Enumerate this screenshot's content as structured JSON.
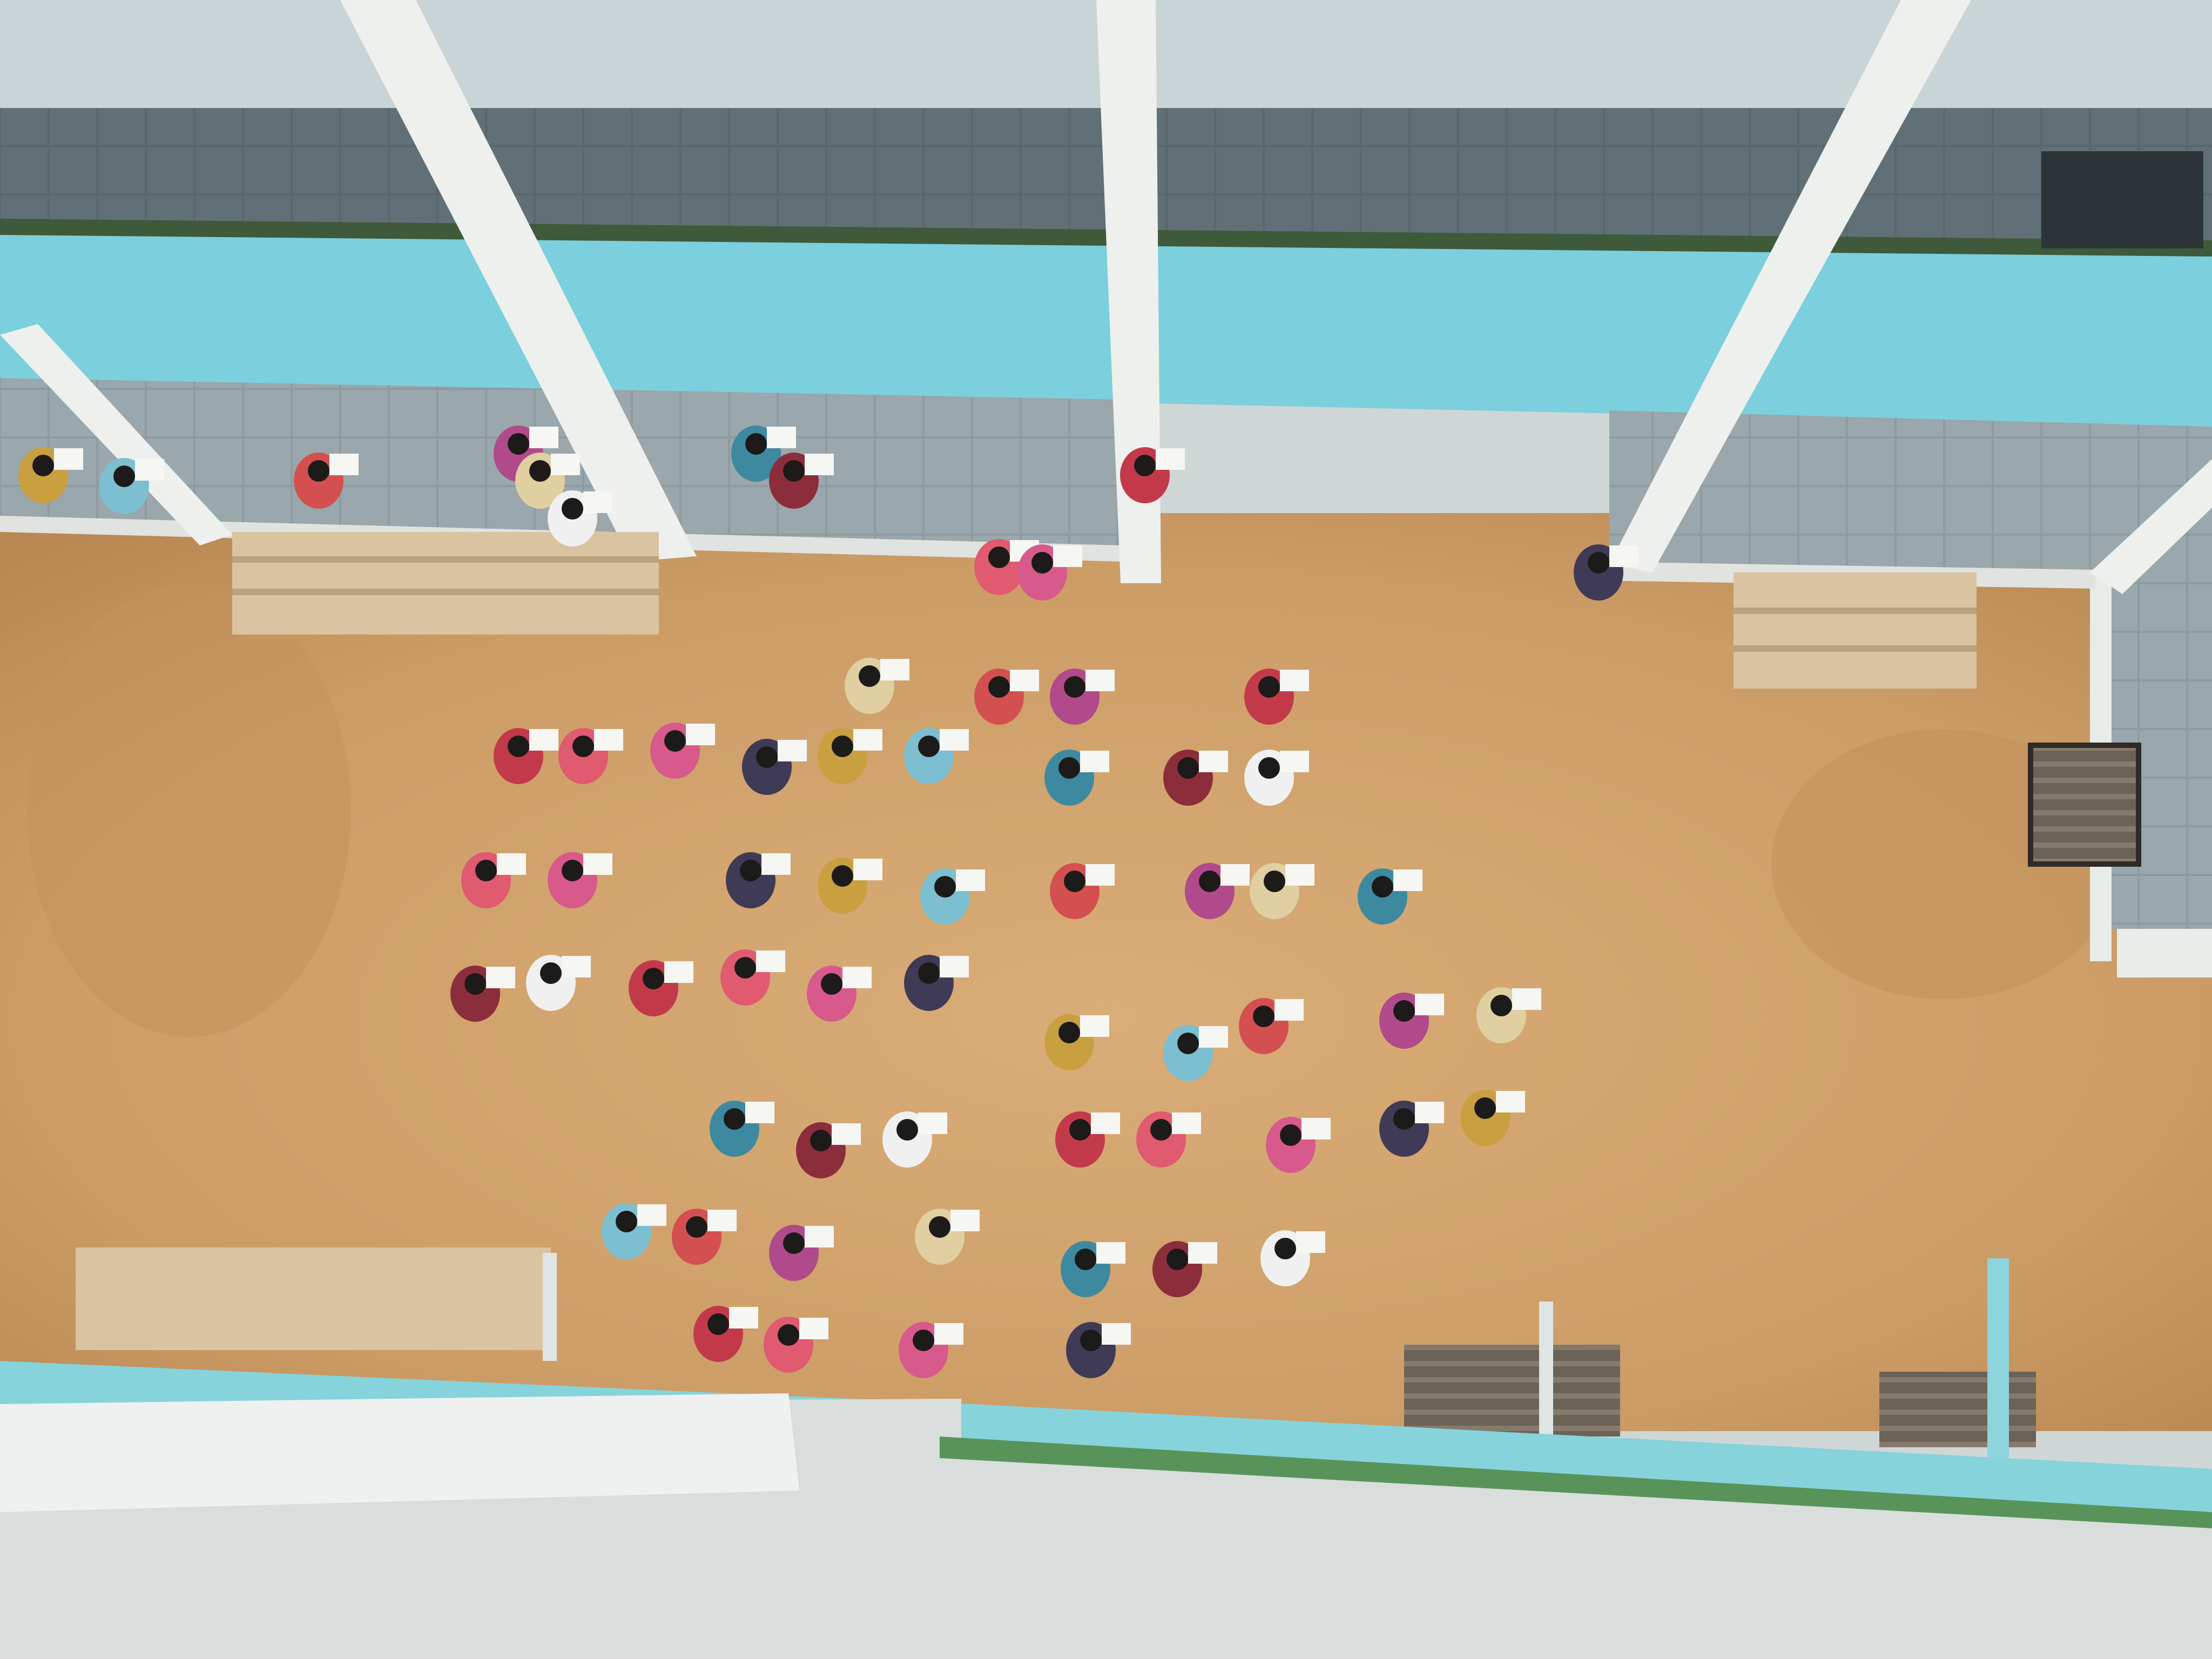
{
  "scene": {
    "description_tag": "aerial-courtyard-students",
    "colors": {
      "sand": "#d4a46e",
      "sand_dark": "#b8834f",
      "corridor_floor": "#6f7f86",
      "upper_floor": "#4f5d63",
      "parapet_cyan": "#7fd0dc",
      "pillar_white": "#eef0ee",
      "roof_grey": "#d8dcda",
      "step_beige": "#d9c3a0"
    }
  }
}
